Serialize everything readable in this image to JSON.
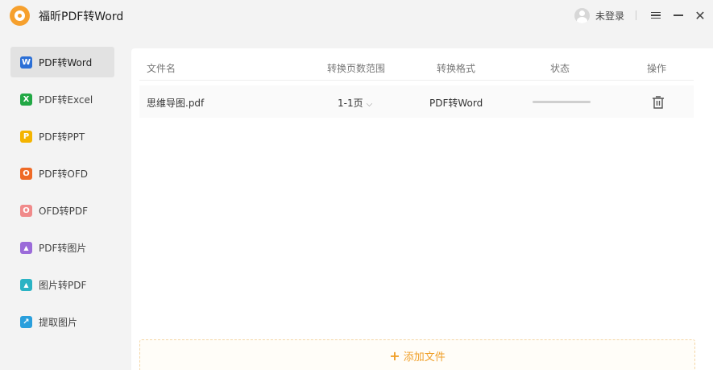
{
  "app": {
    "title": "福昕PDF转Word"
  },
  "header": {
    "login_label": "未登录"
  },
  "sidebar": {
    "items": [
      {
        "label": "PDF转Word",
        "icon": "word-icon",
        "glyph": "W",
        "color": "#2b6fd6",
        "active": true
      },
      {
        "label": "PDF转Excel",
        "icon": "excel-icon",
        "glyph": "X",
        "color": "#22a845",
        "active": false
      },
      {
        "label": "PDF转PPT",
        "icon": "ppt-icon",
        "glyph": "P",
        "color": "#f4b400",
        "active": false
      },
      {
        "label": "PDF转OFD",
        "icon": "ofd-icon",
        "glyph": "O",
        "color": "#ef6a26",
        "active": false
      },
      {
        "label": "OFD转PDF",
        "icon": "ofd-to-pdf-icon",
        "glyph": "O",
        "color": "#f08a8a",
        "active": false
      },
      {
        "label": "PDF转图片",
        "icon": "pdf-to-image-icon",
        "glyph": "▲",
        "color": "#9b6bd9",
        "active": false
      },
      {
        "label": "图片转PDF",
        "icon": "image-to-pdf-icon",
        "glyph": "▲",
        "color": "#2ab3c4",
        "active": false
      },
      {
        "label": "提取图片",
        "icon": "extract-image-icon",
        "glyph": "↗",
        "color": "#2a9fdc",
        "active": false
      }
    ]
  },
  "table": {
    "headers": {
      "filename": "文件名",
      "page_range": "转换页数范围",
      "format": "转换格式",
      "status": "状态",
      "action": "操作"
    },
    "rows": [
      {
        "filename": "思维导图.pdf",
        "page_range": "1-1页",
        "format": "PDF转Word",
        "progress": 0
      }
    ]
  },
  "footer": {
    "add_file_label": "添加文件"
  },
  "colors": {
    "accent": "#f0a02a",
    "active_bg": "#e2e2e2"
  }
}
